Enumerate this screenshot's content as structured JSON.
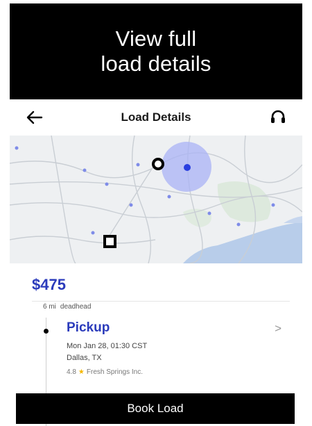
{
  "promo": {
    "line1": "View full",
    "line2": "load details"
  },
  "header": {
    "title": "Load Details"
  },
  "icons": {
    "back": "arrow-left-icon",
    "support": "headset-icon"
  },
  "colors": {
    "accent": "#2b3bbb",
    "star": "#f5b700",
    "pickup_marker": "#2a3fe0"
  },
  "load": {
    "price": "$475",
    "deadhead_distance": "6 mi",
    "deadhead_label": "deadhead",
    "stops": [
      {
        "type": "Pickup",
        "datetime": "Mon Jan 28, 01:30 CST",
        "city": "Dallas, TX",
        "rating": "4.8",
        "shipper": "Fresh Springs Inc."
      }
    ]
  },
  "actions": {
    "book_label": "Book Load"
  }
}
